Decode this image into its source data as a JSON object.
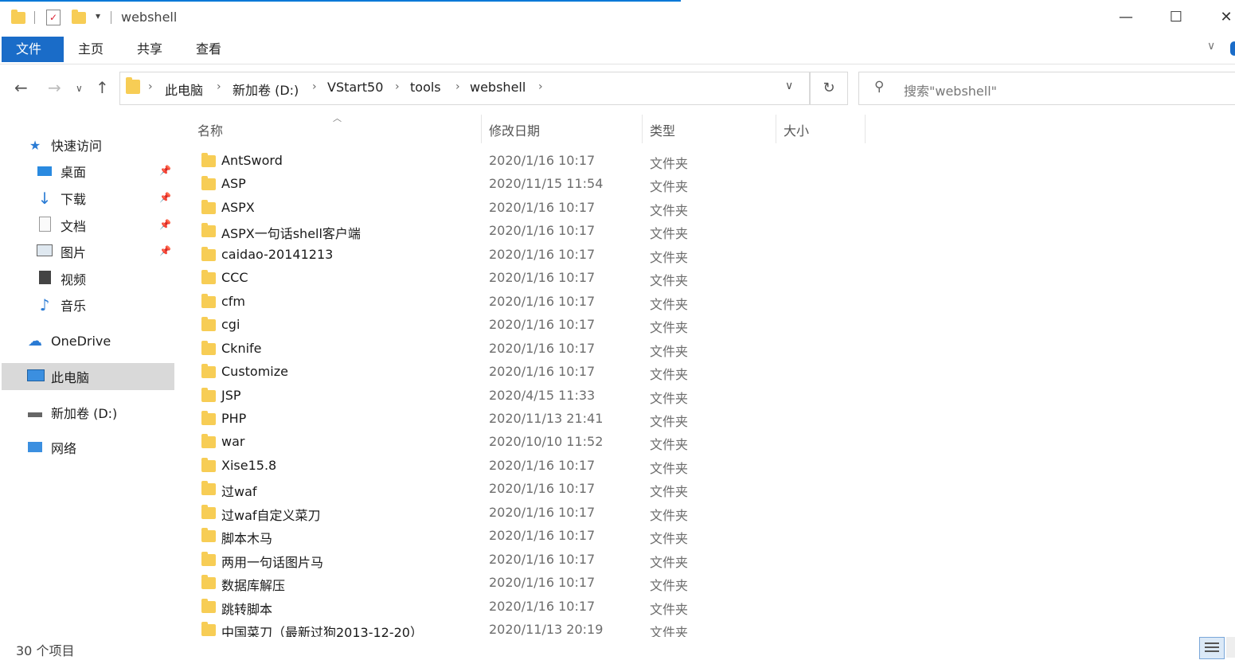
{
  "window": {
    "title": "webshell",
    "minimize_glyph": "—",
    "maximize_glyph": "☐",
    "close_glyph": "✕"
  },
  "ribbon": {
    "tabs": [
      "文件",
      "主页",
      "共享",
      "查看"
    ]
  },
  "address": {
    "crumbs": [
      "此电脑",
      "新加卷 (D:)",
      "VStart50",
      "tools",
      "webshell"
    ],
    "separator": "›"
  },
  "search": {
    "placeholder": "搜索\"webshell\""
  },
  "nav_pane": {
    "quick_access": "快速访问",
    "quick_items": [
      "桌面",
      "下载",
      "文档",
      "图片",
      "视频",
      "音乐"
    ],
    "onedrive": "OneDrive",
    "this_pc": "此电脑",
    "drive": "新加卷 (D:)",
    "network": "网络"
  },
  "columns": {
    "name": "名称",
    "date": "修改日期",
    "type": "类型",
    "size": "大小"
  },
  "files": [
    {
      "name": "AntSword",
      "date": "2020/1/16 10:17",
      "type": "文件夹"
    },
    {
      "name": "ASP",
      "date": "2020/11/15 11:54",
      "type": "文件夹"
    },
    {
      "name": "ASPX",
      "date": "2020/1/16 10:17",
      "type": "文件夹"
    },
    {
      "name": "ASPX一句话shell客户端",
      "date": "2020/1/16 10:17",
      "type": "文件夹"
    },
    {
      "name": "caidao-20141213",
      "date": "2020/1/16 10:17",
      "type": "文件夹"
    },
    {
      "name": "CCC",
      "date": "2020/1/16 10:17",
      "type": "文件夹"
    },
    {
      "name": "cfm",
      "date": "2020/1/16 10:17",
      "type": "文件夹"
    },
    {
      "name": "cgi",
      "date": "2020/1/16 10:17",
      "type": "文件夹"
    },
    {
      "name": "Cknife",
      "date": "2020/1/16 10:17",
      "type": "文件夹"
    },
    {
      "name": "Customize",
      "date": "2020/1/16 10:17",
      "type": "文件夹"
    },
    {
      "name": "JSP",
      "date": "2020/4/15 11:33",
      "type": "文件夹"
    },
    {
      "name": "PHP",
      "date": "2020/11/13 21:41",
      "type": "文件夹"
    },
    {
      "name": "war",
      "date": "2020/10/10 11:52",
      "type": "文件夹"
    },
    {
      "name": "Xise15.8",
      "date": "2020/1/16 10:17",
      "type": "文件夹"
    },
    {
      "name": "过waf",
      "date": "2020/1/16 10:17",
      "type": "文件夹"
    },
    {
      "name": "过waf自定义菜刀",
      "date": "2020/1/16 10:17",
      "type": "文件夹"
    },
    {
      "name": "脚本木马",
      "date": "2020/1/16 10:17",
      "type": "文件夹"
    },
    {
      "name": "两用一句话图片马",
      "date": "2020/1/16 10:17",
      "type": "文件夹"
    },
    {
      "name": "数据库解压",
      "date": "2020/1/16 10:17",
      "type": "文件夹"
    },
    {
      "name": "跳转脚本",
      "date": "2020/1/16 10:17",
      "type": "文件夹"
    },
    {
      "name": "中国菜刀（最新过狗2013-12-20）",
      "date": "2020/11/13 20:19",
      "type": "文件夹"
    }
  ],
  "status": {
    "item_count": "30 个项目"
  }
}
